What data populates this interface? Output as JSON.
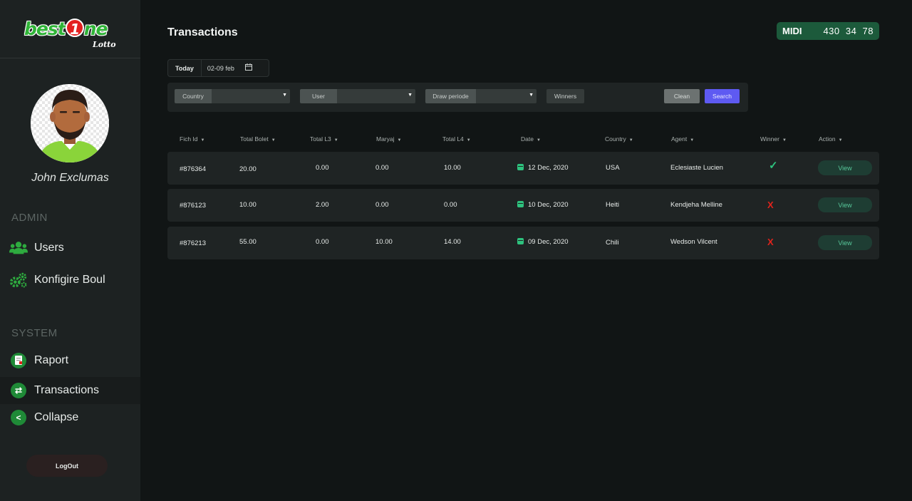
{
  "brand": {
    "name_part1": "best",
    "name_digit": "1",
    "name_part2": "ne",
    "sub": "Lotto"
  },
  "user": {
    "name": "John Exclumas"
  },
  "sidebar": {
    "admin_title": "ADMIN",
    "admin_items": [
      {
        "label": "Users",
        "icon": "users-icon"
      },
      {
        "label": "Konfigire Boul",
        "icon": "gears-icon"
      }
    ],
    "system_title": "SYSTEM",
    "system_items": [
      {
        "label": "Raport",
        "icon": "report-icon"
      },
      {
        "label": "Transactions",
        "icon": "transfer-icon"
      },
      {
        "label": "Collapse",
        "icon": "chevron-left-icon"
      }
    ],
    "logout_label": "LogOut"
  },
  "header": {
    "title": "Transactions",
    "midi": {
      "label": "MIDI",
      "numbers": "430  34  78"
    }
  },
  "date_filter": {
    "today_label": "Today",
    "range": "02-09 feb"
  },
  "filters": {
    "country_label": "Country",
    "user_label": "User",
    "draw_label": "Draw periode",
    "winners_label": "Winners",
    "clean_label": "Clean",
    "search_label": "Search"
  },
  "table": {
    "columns": [
      "Fich Id",
      "Total Bolet",
      "Total L3",
      "Maryaj",
      "Total L4",
      "Date",
      "Country",
      "Agent",
      "Winner",
      "Action"
    ],
    "rows": [
      {
        "fich_id": "#876364",
        "total_bolet": "20.00",
        "total_l3": "0.00",
        "maryaj": "0.00",
        "total_l4": "10.00",
        "date": "12 Dec, 2020",
        "country": "USA",
        "agent": "Eclesiaste Lucien",
        "winner": "✓",
        "action": "View"
      },
      {
        "fich_id": "#876123",
        "total_bolet": "10.00",
        "total_l3": "2.00",
        "maryaj": "0.00",
        "total_l4": "0.00",
        "date": "10 Dec, 2020",
        "country": "Heiti",
        "agent": "Kendjeha Melline",
        "winner": "X",
        "action": "View"
      },
      {
        "fich_id": "#876213",
        "total_bolet": "55.00",
        "total_l3": "0.00",
        "maryaj": "10.00",
        "total_l4": "14.00",
        "date": "09 Dec, 2020",
        "country": "Chili",
        "agent": "Wedson Vilcent",
        "winner": "X",
        "action": "View"
      }
    ]
  },
  "colors": {
    "accent": "#5e5af2",
    "success": "#2ec27e",
    "danger": "#e0231c",
    "brand_green": "#2fb437"
  }
}
